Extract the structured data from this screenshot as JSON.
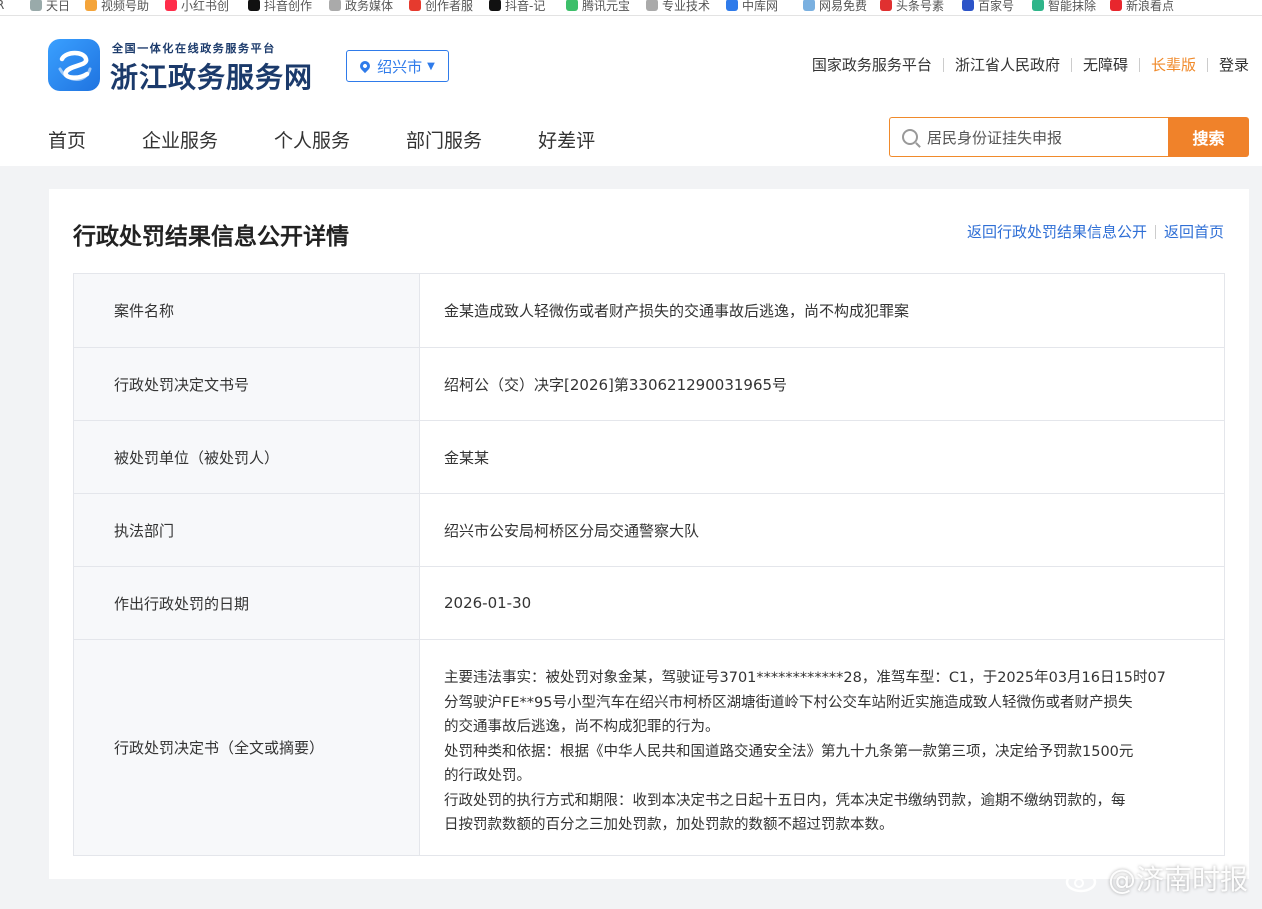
{
  "bookmarks": [
    "R",
    "天日",
    "视频号助",
    "小红书创",
    "抖音创作",
    "政务媒体",
    "创作者服",
    "抖音-记",
    "腾讯元宝",
    "专业技术",
    "中库网",
    "网易免费",
    "头条号素",
    "百家号",
    "智能抹除",
    "新浪看点"
  ],
  "header": {
    "logo_sub": "全国一体化在线政务服务平台",
    "logo_title": "浙江政务服务网",
    "city": "绍兴市",
    "top_links": [
      "国家政务服务平台",
      "浙江省人民政府",
      "无障碍",
      "长辈版",
      "登录"
    ],
    "nav": [
      "首页",
      "企业服务",
      "个人服务",
      "部门服务",
      "好差评"
    ],
    "search_value": "居民身份证挂失申报",
    "search_button": "搜索"
  },
  "panel": {
    "title": "行政处罚结果信息公开详情",
    "link_back_list": "返回行政处罚结果信息公开",
    "link_back_home": "返回首页",
    "rows": [
      {
        "label": "案件名称",
        "value": "金某造成致人轻微伤或者财产损失的交通事故后逃逸，尚不构成犯罪案"
      },
      {
        "label": "行政处罚决定文书号",
        "value": "绍柯公（交）决字[2026]第330621290031965号"
      },
      {
        "label": "被处罚单位（被处罚人）",
        "value": "金某某"
      },
      {
        "label": "执法部门",
        "value": "绍兴市公安局柯桥区分局交通警察大队"
      },
      {
        "label": "作出行政处罚的日期",
        "value": "2026-01-30"
      }
    ],
    "decision": {
      "label": "行政处罚决定书（全文或摘要）",
      "lines": [
        "主要违法事实：被处罚对象金某，驾驶证号3701************28，准驾车型：C1，于2025年03月16日15时07",
        "分驾驶沪FE**95号小型汽车在绍兴市柯桥区湖塘街道岭下村公交车站附近实施造成致人轻微伤或者财产损失",
        "的交通事故后逃逸，尚不构成犯罪的行为。",
        "处罚种类和依据：根据《中华人民共和国道路交通安全法》第九十九条第一款第三项，决定给予罚款1500元",
        "的行政处罚。",
        "行政处罚的执行方式和期限：收到本决定书之日起十五日内，凭本决定书缴纳罚款，逾期不缴纳罚款的，每",
        "日按罚款数额的百分之三加处罚款，加处罚款的数额不超过罚款本数。"
      ]
    }
  },
  "watermark": "@济南时报"
}
